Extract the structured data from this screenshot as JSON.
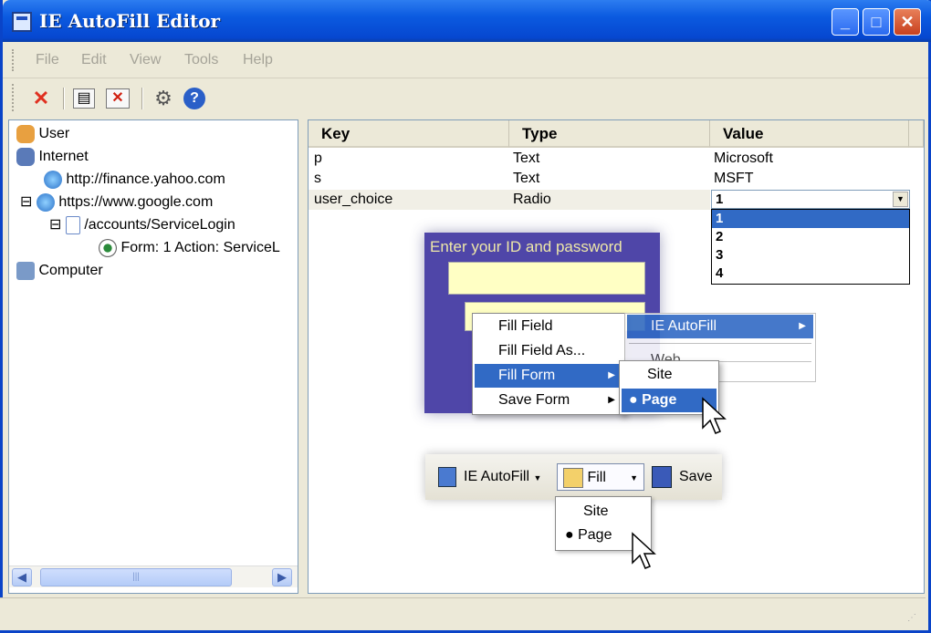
{
  "window": {
    "title": "IE AutoFill Editor"
  },
  "menubar": {
    "items": [
      "File",
      "Edit",
      "View",
      "Tools",
      "Help"
    ]
  },
  "toolbar": {
    "icons": [
      "delete-icon",
      "properties-icon",
      "remove-icon",
      "settings-icon",
      "help-icon"
    ]
  },
  "tree": {
    "items": [
      {
        "label": "User",
        "icon": "users-icon"
      },
      {
        "label": "Internet",
        "icon": "network-icon"
      },
      {
        "label": "http://finance.yahoo.com",
        "icon": "globe-icon"
      },
      {
        "label": "https://www.google.com",
        "icon": "globe-icon",
        "expander": "⊟"
      },
      {
        "label": "/accounts/ServiceLogin",
        "icon": "page-icon",
        "expander": "⊟"
      },
      {
        "label": "Form: 1 Action: ServiceL",
        "icon": "form-icon"
      },
      {
        "label": "Computer",
        "icon": "computer-icon"
      }
    ]
  },
  "grid": {
    "columns": [
      "Key",
      "Type",
      "Value"
    ],
    "rows": [
      {
        "key": "p",
        "type": "Text",
        "value": "Microsoft"
      },
      {
        "key": "s",
        "type": "Text",
        "value": "MSFT"
      },
      {
        "key": "user_choice",
        "type": "Radio",
        "value": "1"
      }
    ],
    "dropdown_options": [
      "1",
      "2",
      "3",
      "4"
    ]
  },
  "overlay": {
    "login_title": "Enter your ID and password",
    "context_menu": [
      "Fill Field",
      "Fill Field As...",
      "Fill Form",
      "Save Form"
    ],
    "submenu_autofill": "IE AutoFill",
    "submenu_partial": "Web",
    "fill_form_sub": [
      "Site",
      "Page"
    ],
    "mini_toolbar": {
      "autofill": "IE AutoFill",
      "fill": "Fill",
      "save": "Save"
    },
    "fill_dropdown": [
      "Site",
      "Page"
    ]
  },
  "colors": {
    "titlebar": "#0b5ae0",
    "highlight": "#316ac5",
    "login_bg": "#4f46a8"
  }
}
